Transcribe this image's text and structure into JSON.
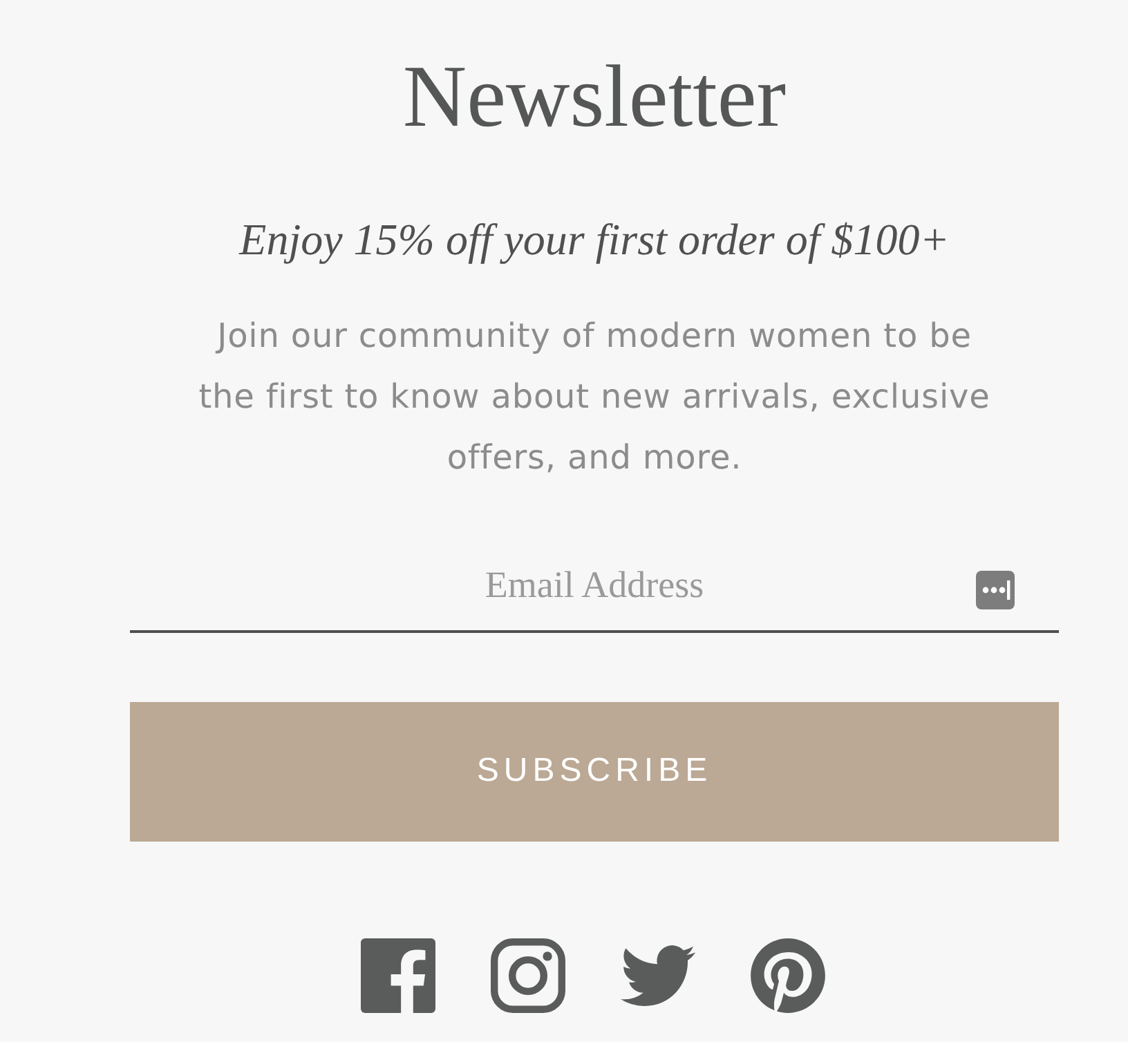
{
  "heading": "Newsletter",
  "offer": "Enjoy 15% off your first order of $100+",
  "description": "Join our community of modern women to be the first to know about new arrivals, exclusive offers, and more.",
  "email_field": {
    "placeholder": "Email Address"
  },
  "subscribe_button": {
    "label": "SUBSCRIBE"
  }
}
